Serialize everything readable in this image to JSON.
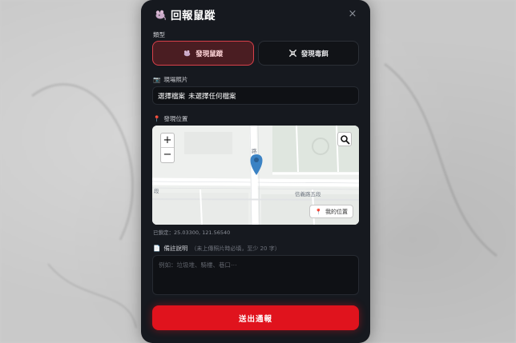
{
  "modal": {
    "title": "回報鼠蹤",
    "close_label": "×"
  },
  "type_section": {
    "label": "類型",
    "options": [
      {
        "label": "發現鼠蹤",
        "icon": "rat-icon",
        "selected": true
      },
      {
        "label": "發現毒餌",
        "icon": "skull-crossbones-icon",
        "selected": false
      }
    ]
  },
  "photo_section": {
    "label": "現場照片",
    "icon": "camera-icon",
    "file_button": "選擇檔案",
    "file_status": "未選擇任何檔案"
  },
  "location_section": {
    "label": "發現位置",
    "icon": "pin-icon",
    "map": {
      "zoom_in": "+",
      "zoom_out": "−",
      "search_icon": "search-icon",
      "my_location_label": "我的位置",
      "road_labels": [
        "信義路五段",
        "路",
        "段"
      ]
    },
    "coordinates_text": "已鎖定：25.03300, 121.56540"
  },
  "note_section": {
    "label": "備註說明",
    "icon": "document-icon",
    "hint": "（未上傳照片時必填，至少 20 字）",
    "placeholder": "例如：垃圾堆、騎樓、巷口⋯"
  },
  "submit_label": "送出通報",
  "colors": {
    "modal_bg": "#16191f",
    "accent_red": "#e0131d",
    "selected_bg": "#4a1d22",
    "map_pin": "#3b82c4"
  }
}
